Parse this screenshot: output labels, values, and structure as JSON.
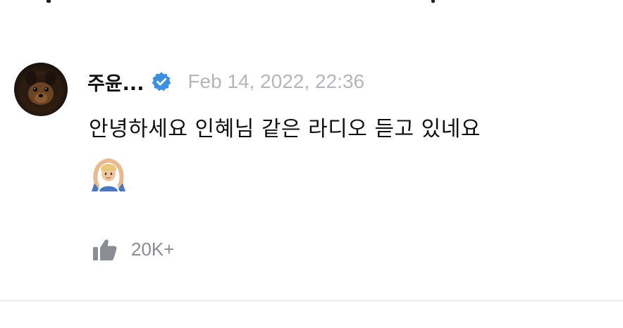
{
  "comment": {
    "username": "주윤...",
    "verified": true,
    "timestamp": "Feb 14, 2022, 22:36",
    "text": "안녕하세요 인혜님 같은 라디오 듣고 있네요",
    "emoji": "person-gesturing-ok-emoji",
    "likes": "20K+"
  },
  "icons": {
    "verified": "verified-badge-icon",
    "like": "thumbs-up-icon",
    "avatar": "dog-avatar"
  },
  "colors": {
    "verified_badge": "#3d8fe0",
    "timestamp": "#b3b6bb",
    "like": "#8a8d93",
    "text": "#111111",
    "divider": "#ececee"
  }
}
